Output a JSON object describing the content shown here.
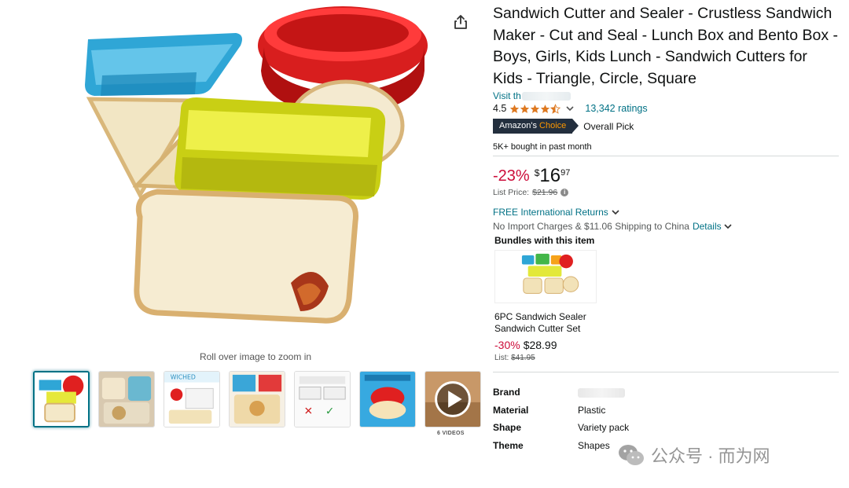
{
  "gallery": {
    "zoom_hint": "Roll over image to zoom in",
    "videos_label": "6 VIDEOS",
    "thumbnails": [
      "thumb-1",
      "thumb-2",
      "thumb-3",
      "thumb-4",
      "thumb-5",
      "thumb-6",
      "thumb-video"
    ]
  },
  "product": {
    "title": "Sandwich Cutter and Sealer - Crustless Sandwich Maker - Cut and Seal - Lunch Box and Bento Box - Boys, Girls, Kids Lunch - Sandwich Cutters for Kids - Triangle, Circle, Square",
    "store_prefix": "Visit th",
    "rating": "4.5",
    "ratings_count": "13,342 ratings",
    "badge_main": "Amazon's",
    "badge_accent": "Choice",
    "badge_label": "Overall Pick",
    "bought": "5K+ bought in past month",
    "discount": "-23%",
    "price_symbol": "$",
    "price_whole": "16",
    "price_fraction": "97",
    "list_price_label": "List Price:",
    "list_price": "$21.96",
    "returns": "FREE International Returns",
    "import_charges": "No Import Charges & $11.06 Shipping to China",
    "details": "Details"
  },
  "bundle": {
    "title": "Bundles with this item",
    "name": "6PC Sandwich Sealer Sandwich Cutter Set",
    "discount": "-30%",
    "price": "$28.99",
    "list_label": "List:",
    "list_price": "$41.95"
  },
  "specs": [
    {
      "key": "Brand",
      "value": ""
    },
    {
      "key": "Material",
      "value": "Plastic"
    },
    {
      "key": "Shape",
      "value": "Variety pack"
    },
    {
      "key": "Theme",
      "value": "Shapes"
    }
  ],
  "watermark": "公众号 · 而为网",
  "colors": {
    "link": "#007185",
    "deal_red": "#CC0C39",
    "badge_bg": "#232F3E",
    "badge_accent": "#FF9900",
    "star": "#DE7921"
  }
}
